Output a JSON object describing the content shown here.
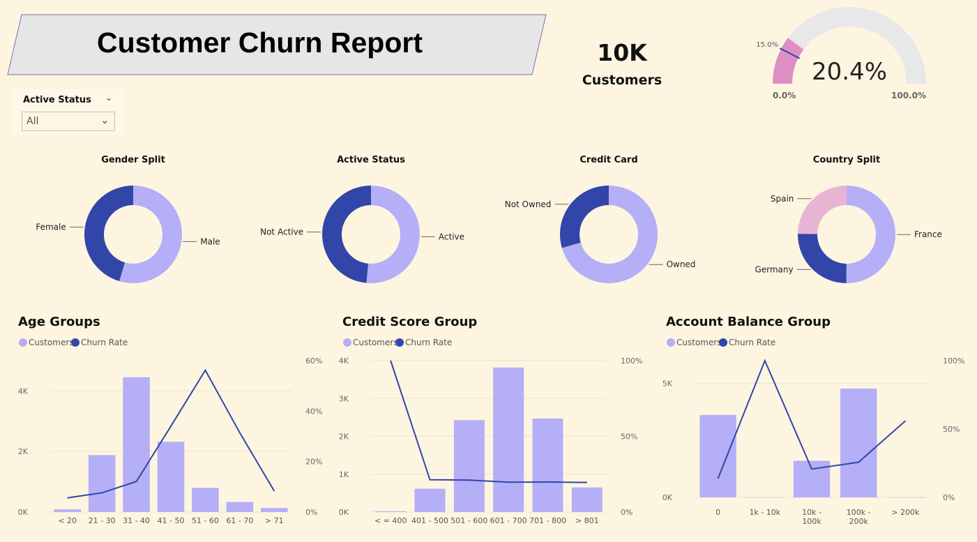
{
  "title": "Customer Churn Report",
  "kpi": {
    "value": "10K",
    "label": "Customers"
  },
  "gauge": {
    "value_label": "20.4%",
    "value": 20.4,
    "min_label": "0.0%",
    "max_label": "100.0%",
    "target_label": "15.0%",
    "target": 15.0,
    "fill_color": "#de8fc4",
    "track_color": "#e8e8e8",
    "target_color": "#3545a6"
  },
  "slicer": {
    "title": "Active Status",
    "value": "All"
  },
  "colors": {
    "light": "#b4aff6",
    "dark": "#3245a8",
    "pink": "#e8b4d4"
  },
  "donuts": [
    {
      "title": "Gender Split",
      "slices": [
        {
          "label": "Male",
          "value": 54.6,
          "color": "#b4aff6"
        },
        {
          "label": "Female",
          "value": 45.4,
          "color": "#3245a8"
        }
      ]
    },
    {
      "title": "Active Status",
      "slices": [
        {
          "label": "Active",
          "value": 51.5,
          "color": "#b4aff6"
        },
        {
          "label": "Not Active",
          "value": 48.5,
          "color": "#3245a8"
        }
      ]
    },
    {
      "title": "Credit Card",
      "slices": [
        {
          "label": "Owned",
          "value": 70.5,
          "color": "#b4aff6"
        },
        {
          "label": "Not Owned",
          "value": 29.5,
          "color": "#3245a8"
        }
      ]
    },
    {
      "title": "Country Split",
      "slices": [
        {
          "label": "France",
          "value": 50.1,
          "color": "#b4aff6"
        },
        {
          "label": "Germany",
          "value": 25.1,
          "color": "#3245a8"
        },
        {
          "label": "Spain",
          "value": 24.8,
          "color": "#e8b4d4"
        }
      ]
    }
  ],
  "chart_data": [
    {
      "type": "bar",
      "title": "Age Groups",
      "legend": [
        "Customers",
        "Churn Rate"
      ],
      "categories": [
        "< 20",
        "21 - 30",
        "31 - 40",
        "41 - 50",
        "51 - 60",
        "61 - 70",
        "> 71"
      ],
      "series": [
        {
          "name": "Customers",
          "type": "bar",
          "axis": "left",
          "values": [
            89,
            1879,
            4451,
            2320,
            797,
            331,
            133
          ]
        },
        {
          "name": "Churn Rate",
          "type": "line",
          "axis": "right",
          "values": [
            5.6,
            7.6,
            12.1,
            34.0,
            56.2,
            31.4,
            8.3
          ]
        }
      ],
      "y_left": {
        "ticks": [
          0,
          2000,
          4000
        ],
        "tick_labels": [
          "0K",
          "2K",
          "4K"
        ],
        "max": 5000
      },
      "y_right": {
        "ticks": [
          0,
          20,
          40,
          60
        ],
        "tick_labels": [
          "0%",
          "20%",
          "40%",
          "60%"
        ],
        "max": 60
      }
    },
    {
      "type": "bar",
      "title": "Credit Score Group",
      "legend": [
        "Customers",
        "Churn Rate"
      ],
      "categories": [
        "< = 400",
        "401 - 500",
        "501 - 600",
        "601 - 700",
        "701 - 800",
        "> 801"
      ],
      "series": [
        {
          "name": "Customers",
          "type": "bar",
          "axis": "left",
          "values": [
            19,
            615,
            2427,
            3818,
            2471,
            650
          ]
        },
        {
          "name": "Churn Rate",
          "type": "line",
          "axis": "right",
          "values": [
            100,
            21.3,
            21.1,
            19.7,
            19.8,
            19.5
          ]
        }
      ],
      "y_left": {
        "ticks": [
          0,
          1000,
          2000,
          3000,
          4000
        ],
        "tick_labels": [
          "0K",
          "1K",
          "2K",
          "3K",
          "4K"
        ],
        "max": 4000
      },
      "y_right": {
        "ticks": [
          0,
          50,
          100
        ],
        "tick_labels": [
          "0%",
          "50%",
          "100%"
        ],
        "max": 100
      }
    },
    {
      "type": "bar",
      "title": "Account Balance Group",
      "legend": [
        "Customers",
        "Churn Rate"
      ],
      "categories": [
        "0",
        "1k - 10k",
        "10k - 100k",
        "100k - 200k",
        "> 200k"
      ],
      "series": [
        {
          "name": "Customers",
          "type": "bar",
          "axis": "left",
          "values": [
            3617,
            2,
            1606,
            4775,
            0
          ]
        },
        {
          "name": "Churn Rate",
          "type": "line",
          "axis": "right",
          "values": [
            13.8,
            100,
            20.7,
            25.7,
            56.0
          ]
        }
      ],
      "y_left": {
        "ticks": [
          0,
          5000
        ],
        "tick_labels": [
          "0K",
          "5K"
        ],
        "max": 6000
      },
      "y_right": {
        "ticks": [
          0,
          50,
          100
        ],
        "tick_labels": [
          "0%",
          "50%",
          "100%"
        ],
        "max": 100
      }
    }
  ]
}
